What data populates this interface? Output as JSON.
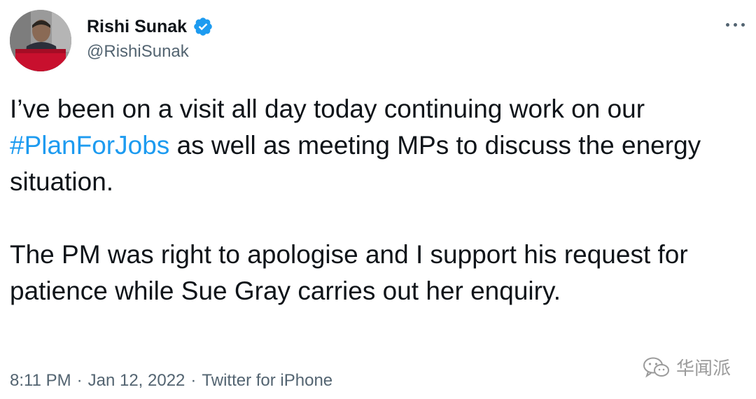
{
  "author": {
    "display_name": "Rishi Sunak",
    "handle": "@RishiSunak",
    "verified": true,
    "avatar_icon": "profile-photo-avatar"
  },
  "tweet": {
    "paragraph1_before": "I’ve been on a visit all day today continuing work on our ",
    "hashtag": "#PlanForJobs",
    "paragraph1_after": " as well as meeting MPs to discuss the energy situation.",
    "paragraph2": "The PM was right to apologise and I support his request for patience while Sue Gray carries out her enquiry."
  },
  "meta": {
    "time": "8:11 PM",
    "separator1": "·",
    "date": "Jan 12, 2022",
    "separator2": "·",
    "source": "Twitter for iPhone"
  },
  "watermark": {
    "text": "华闻派",
    "icon": "wechat-icon"
  },
  "colors": {
    "hashtag": "#1d9bf0",
    "verified_badge": "#1d9bf0",
    "secondary_text": "#536471",
    "primary_text": "#0f1419"
  }
}
